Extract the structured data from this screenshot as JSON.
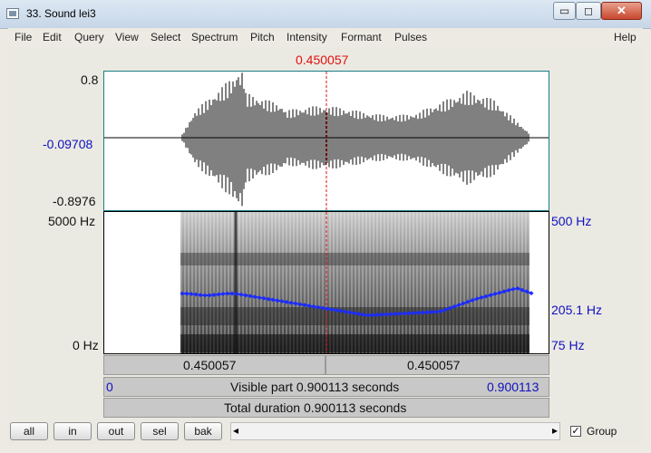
{
  "window": {
    "title": "33. Sound lei3",
    "min_glyph": "▭",
    "max_glyph": "◻",
    "close_glyph": "✕"
  },
  "menu": [
    "File",
    "Edit",
    "Query",
    "View",
    "Select",
    "Spectrum",
    "Pitch",
    "Intensity",
    "Formant",
    "Pulses"
  ],
  "help": "Help",
  "cursor_time": "0.450057",
  "waveform": {
    "ymax": "0.8",
    "yzero": "-0.09708",
    "ymin": "-0.8976"
  },
  "spectrogram": {
    "fmax": "5000 Hz",
    "fmin": "0 Hz"
  },
  "pitch": {
    "max": "500 Hz",
    "current": "205.1 Hz",
    "min": "75 Hz"
  },
  "time_bar": {
    "left": "0.450057",
    "right": "0.450057"
  },
  "visible_bar": {
    "start": "0",
    "text": "Visible part 0.900113 seconds",
    "end": "0.900113"
  },
  "total_bar": {
    "text": "Total duration 0.900113 seconds"
  },
  "buttons": {
    "all": "all",
    "in": "in",
    "out": "out",
    "sel": "sel",
    "bak": "bak"
  },
  "scroll": {
    "left_arrow": "◂",
    "right_arrow": "▸"
  },
  "group": {
    "label": "Group",
    "checked": "✓"
  },
  "colors": {
    "cursor": "#e01010",
    "pitch_axis": "#1010c0",
    "pitch_curve": "#1c2cff"
  }
}
